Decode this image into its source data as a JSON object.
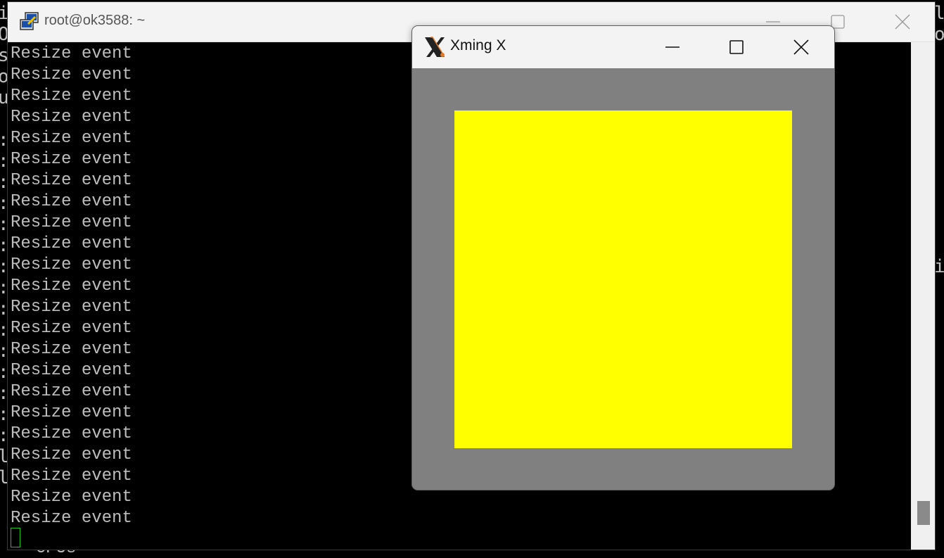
{
  "background_terminal": {
    "left_chars": [
      "i",
      "O",
      "s",
      "o",
      "u",
      "",
      ":",
      ":",
      ":",
      ":",
      ":",
      ":",
      ":",
      ":",
      ":",
      ":",
      ":",
      ":",
      ":",
      ":",
      ":",
      "l",
      "l"
    ],
    "right_chars": [
      "l",
      "o",
      "",
      "",
      "",
      "",
      "",
      "",
      "",
      "",
      "",
      "",
      "i"
    ],
    "bottom_text": "- CPUs"
  },
  "putty": {
    "title": "root@ok3588: ~",
    "icon": "putty-icon",
    "lines": [
      "Resize event",
      "Resize event",
      "Resize event",
      "Resize event",
      "Resize event",
      "Resize event",
      "Resize event",
      "Resize event",
      "Resize event",
      "Resize event",
      "Resize event",
      "Resize event",
      "Resize event",
      "Resize event",
      "Resize event",
      "Resize event",
      "Resize event",
      "Resize event",
      "Resize event",
      "Resize event",
      "Resize event",
      "Resize event",
      "Resize event"
    ]
  },
  "xming": {
    "title": "Xming X",
    "icon": "xming-x-icon"
  },
  "colors": {
    "terminal_bg": "#000000",
    "terminal_text": "#bdbdbd",
    "cursor": "#17c617",
    "xming_bg": "#808080",
    "square": "#ffff00"
  }
}
